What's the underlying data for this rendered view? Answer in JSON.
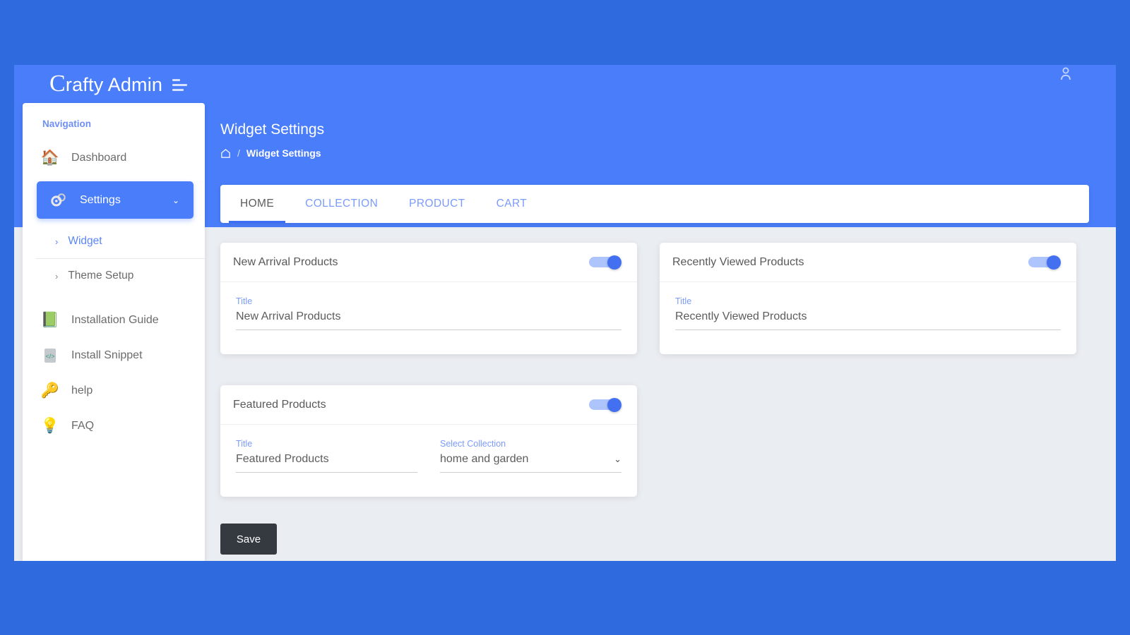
{
  "brand": {
    "initial": "C",
    "name": "rafty Admin",
    "menu_icon": "hamburger-icon",
    "account_icon": "account-icon"
  },
  "page": {
    "title": "Widget Settings",
    "breadcrumb": {
      "home_icon": "home-icon",
      "separator": "/",
      "current": "Widget Settings"
    }
  },
  "sidebar": {
    "heading": "Navigation",
    "items": [
      {
        "label": "Dashboard",
        "icon": "house-icon",
        "glyph": "🏠",
        "active": false
      },
      {
        "label": "Settings",
        "icon": "gears-icon",
        "glyph": "⚙",
        "active": true,
        "chevron": "⌄"
      }
    ],
    "sub_items": [
      {
        "label": "Widget",
        "arrow": "›",
        "selected": true
      },
      {
        "label": "Theme Setup",
        "arrow": "›",
        "selected": false
      }
    ],
    "extra_items": [
      {
        "label": "Installation Guide",
        "icon": "book-icon",
        "glyph": "📗"
      },
      {
        "label": "Install Snippet",
        "icon": "code-file-icon",
        "glyph": "📄"
      },
      {
        "label": "help",
        "icon": "key-icon",
        "glyph": "🔑"
      },
      {
        "label": "FAQ",
        "icon": "lightbulb-icon",
        "glyph": "💡"
      }
    ]
  },
  "tabs": [
    {
      "label": "HOME",
      "active": true
    },
    {
      "label": "COLLECTION",
      "active": false
    },
    {
      "label": "PRODUCT",
      "active": false
    },
    {
      "label": "CART",
      "active": false
    }
  ],
  "widgets": [
    {
      "header": "New Arrival Products",
      "enabled": true,
      "fields": [
        {
          "label": "Title",
          "value": "New Arrival Products",
          "type": "text"
        }
      ]
    },
    {
      "header": "Recently Viewed Products",
      "enabled": true,
      "fields": [
        {
          "label": "Title",
          "value": "Recently Viewed Products",
          "type": "text"
        }
      ]
    },
    {
      "header": "Featured Products",
      "enabled": true,
      "fields": [
        {
          "label": "Title",
          "value": "Featured Products",
          "type": "text"
        },
        {
          "label": "Select Collection",
          "value": "home and garden",
          "type": "select",
          "chevron": "⌄"
        }
      ]
    }
  ],
  "actions": {
    "save_label": "Save"
  },
  "colors": {
    "page_background": "#2f6ade",
    "header_blue": "#4a7dfa",
    "content_background": "#eaedf2",
    "accent": "#3c6ef5",
    "toggle_track": "#aec4fd",
    "toggle_knob": "#4270f0",
    "save_button": "#343a40",
    "label_blue": "#7b9bfb"
  }
}
